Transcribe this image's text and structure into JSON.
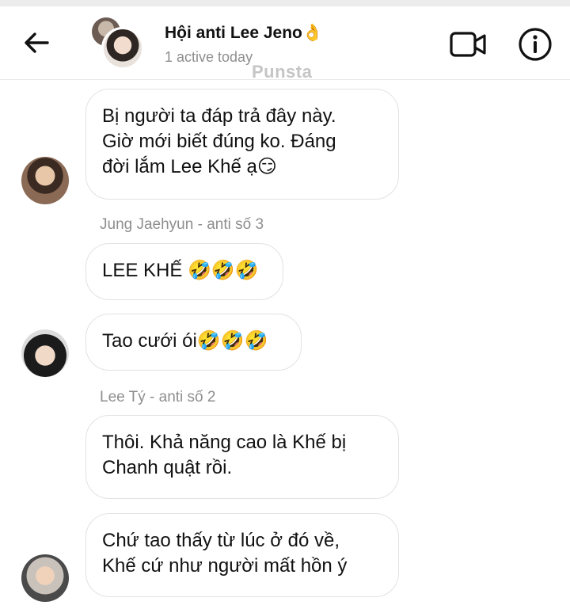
{
  "header": {
    "title": "Hội anti Lee Jeno👌",
    "status": "1 active today",
    "watermark": "Punsta"
  },
  "icons": {
    "back": "arrow-left-icon",
    "video": "video-call-icon",
    "info": "info-icon"
  },
  "messages": [
    {
      "text_line1": "Bị người ta đáp trả đây này.",
      "text_line2": "Giờ mới biết đúng ko. Đáng",
      "text_line3": "đời lắm Lee Khế ạ😏"
    },
    {
      "sender": "Jung Jaehyun - anti số 3",
      "text": "LEE KHẾ 🤣🤣🤣"
    },
    {
      "text": "Tao cưới ói🤣🤣🤣"
    },
    {
      "sender": "Lee Tý - anti số 2",
      "text_line1": "Thôi. Khả năng cao là Khế bị",
      "text_line2": "Chanh quật rồi."
    },
    {
      "text_line1": "Chứ tao thấy từ lúc ở đó về,",
      "text_line2": "Khế cứ như người mất hồn ý"
    }
  ]
}
